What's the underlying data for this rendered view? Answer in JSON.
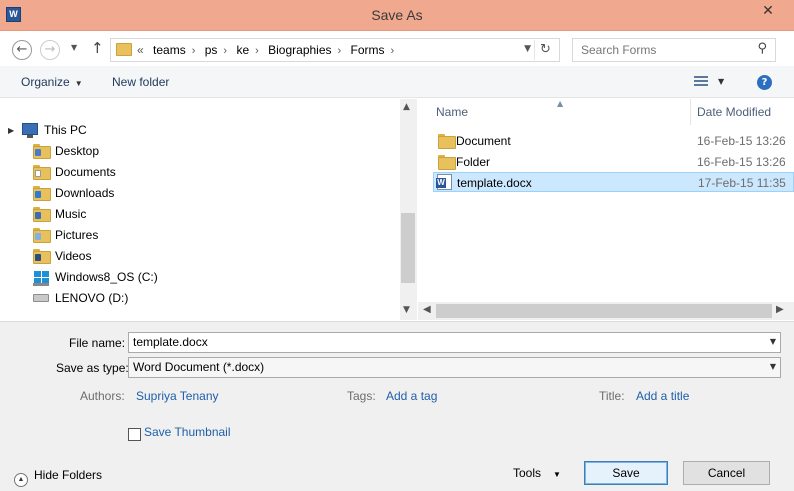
{
  "window": {
    "title": "Save As",
    "app_icon": "W",
    "close_glyph": "✕"
  },
  "nav": {
    "back_glyph": "←",
    "forward_glyph": "→",
    "up_glyph": "↑",
    "breadcrumb_lead": "«",
    "breadcrumb": [
      "teams",
      "ps",
      "ke",
      "Biographies",
      "Forms"
    ],
    "search_placeholder": "Search Forms"
  },
  "toolbar": {
    "organize": "Organize",
    "new_folder": "New folder",
    "help": "?"
  },
  "nav_pane": {
    "items": [
      {
        "label": "This PC",
        "icon": "pc-icon"
      },
      {
        "label": "Desktop",
        "icon": "folder-icon"
      },
      {
        "label": "Documents",
        "icon": "folder-icon"
      },
      {
        "label": "Downloads",
        "icon": "folder-icon"
      },
      {
        "label": "Music",
        "icon": "folder-icon"
      },
      {
        "label": "Pictures",
        "icon": "folder-icon"
      },
      {
        "label": "Videos",
        "icon": "folder-icon"
      },
      {
        "label": "Windows8_OS (C:)",
        "icon": "windows-drive-icon"
      },
      {
        "label": "LENOVO (D:)",
        "icon": "drive-icon"
      }
    ]
  },
  "file_list": {
    "columns": {
      "name": "Name",
      "date": "Date Modified"
    },
    "rows": [
      {
        "name": "Document",
        "date": "16-Feb-15 13:26",
        "type": "folder"
      },
      {
        "name": "Folder",
        "date": "16-Feb-15 13:26",
        "type": "folder"
      },
      {
        "name": "template.docx",
        "date": "17-Feb-15 11:35",
        "type": "word-document",
        "selected": true
      }
    ]
  },
  "form": {
    "file_name_label": "File name:",
    "file_name_value": "template.docx",
    "save_type_label": "Save as type:",
    "save_type_value": "Word Document (*.docx)",
    "authors_label": "Authors:",
    "authors_value": "Supriya Tenany",
    "tags_label": "Tags:",
    "tags_value": "Add a tag",
    "title_label": "Title:",
    "title_value": "Add a title",
    "thumbnail_label": "Save Thumbnail",
    "thumbnail_checked": false
  },
  "footer": {
    "hide_folders": "Hide Folders",
    "tools": "Tools",
    "save": "Save",
    "cancel": "Cancel"
  },
  "colors": {
    "titlebar": "#f0a98f",
    "selection": "#cce8ff",
    "link": "#1f5fa8"
  }
}
